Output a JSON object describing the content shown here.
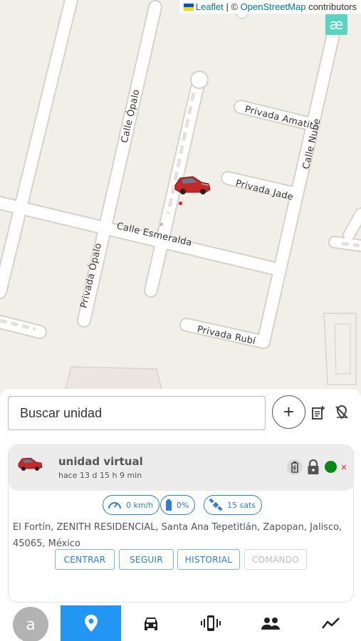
{
  "map": {
    "attribution": {
      "leaflet": "Leaflet",
      "separator": "|",
      "copyright": "©",
      "osm": "OpenStreetMap",
      "contributors": "contributors"
    },
    "logo_text": "æ",
    "streets": [
      {
        "label": "Calle Ópalo"
      },
      {
        "label": "Privada Amatita"
      },
      {
        "label": "Calle Nube"
      },
      {
        "label": "Privada Jade"
      },
      {
        "label": "Calle Esmeralda"
      },
      {
        "label": "Privada Ópalo"
      },
      {
        "label": "Privada Rubí"
      }
    ],
    "colors": {
      "background": "#f2efe9",
      "road": "#ffffff",
      "road_outline": "#d8d4cd",
      "building": "#e3dfd8"
    }
  },
  "search": {
    "placeholder": "Buscar unidad"
  },
  "toolbar": {
    "add_label": "+"
  },
  "unit": {
    "name": "unidad virtual",
    "last_seen": "hace 13 d 15 h 9 min",
    "status_color": "#0a8a14",
    "close_label": "×",
    "chips": {
      "speed": "0 km/h",
      "battery": "0%",
      "satellites": "15 sats"
    },
    "address": "El Fortín, ZENITH RESIDENCIAL, Santa Ana Tepetitlán, Zapopan, Jalisco, 45065, México",
    "actions": {
      "center": "CENTRAR",
      "follow": "SEGUIR",
      "history": "HISTORIAL",
      "command": "COMANDO"
    }
  },
  "nav": {
    "avatar_letter": "a",
    "accent": "#2196f3",
    "items": [
      "map-pin-icon",
      "car-icon",
      "device-vibrate-icon",
      "people-icon",
      "chart-line-icon"
    ]
  }
}
